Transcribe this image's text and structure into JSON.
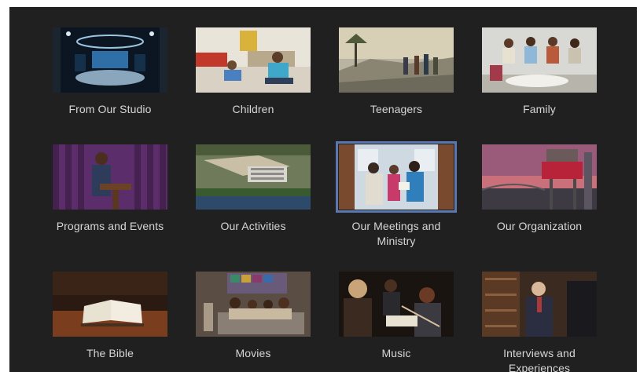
{
  "categories": [
    {
      "label": "From Our Studio",
      "icon": "studio-thumbnail"
    },
    {
      "label": "Children",
      "icon": "children-thumbnail"
    },
    {
      "label": "Teenagers",
      "icon": "teenagers-thumbnail"
    },
    {
      "label": "Family",
      "icon": "family-thumbnail"
    },
    {
      "label": "Programs and Events",
      "icon": "programs-thumbnail"
    },
    {
      "label": "Our Activities",
      "icon": "activities-thumbnail"
    },
    {
      "label": "Our Meetings and Ministry",
      "icon": "meetings-thumbnail",
      "selected": true
    },
    {
      "label": "Our Organization",
      "icon": "organization-thumbnail"
    },
    {
      "label": "The Bible",
      "icon": "bible-thumbnail"
    },
    {
      "label": "Movies",
      "icon": "movies-thumbnail"
    },
    {
      "label": "Music",
      "icon": "music-thumbnail"
    },
    {
      "label": "Interviews and Experiences",
      "icon": "interviews-thumbnail"
    }
  ],
  "colors": {
    "background": "#202020",
    "label": "#d6d6d6",
    "selection": "#5b77b0"
  }
}
